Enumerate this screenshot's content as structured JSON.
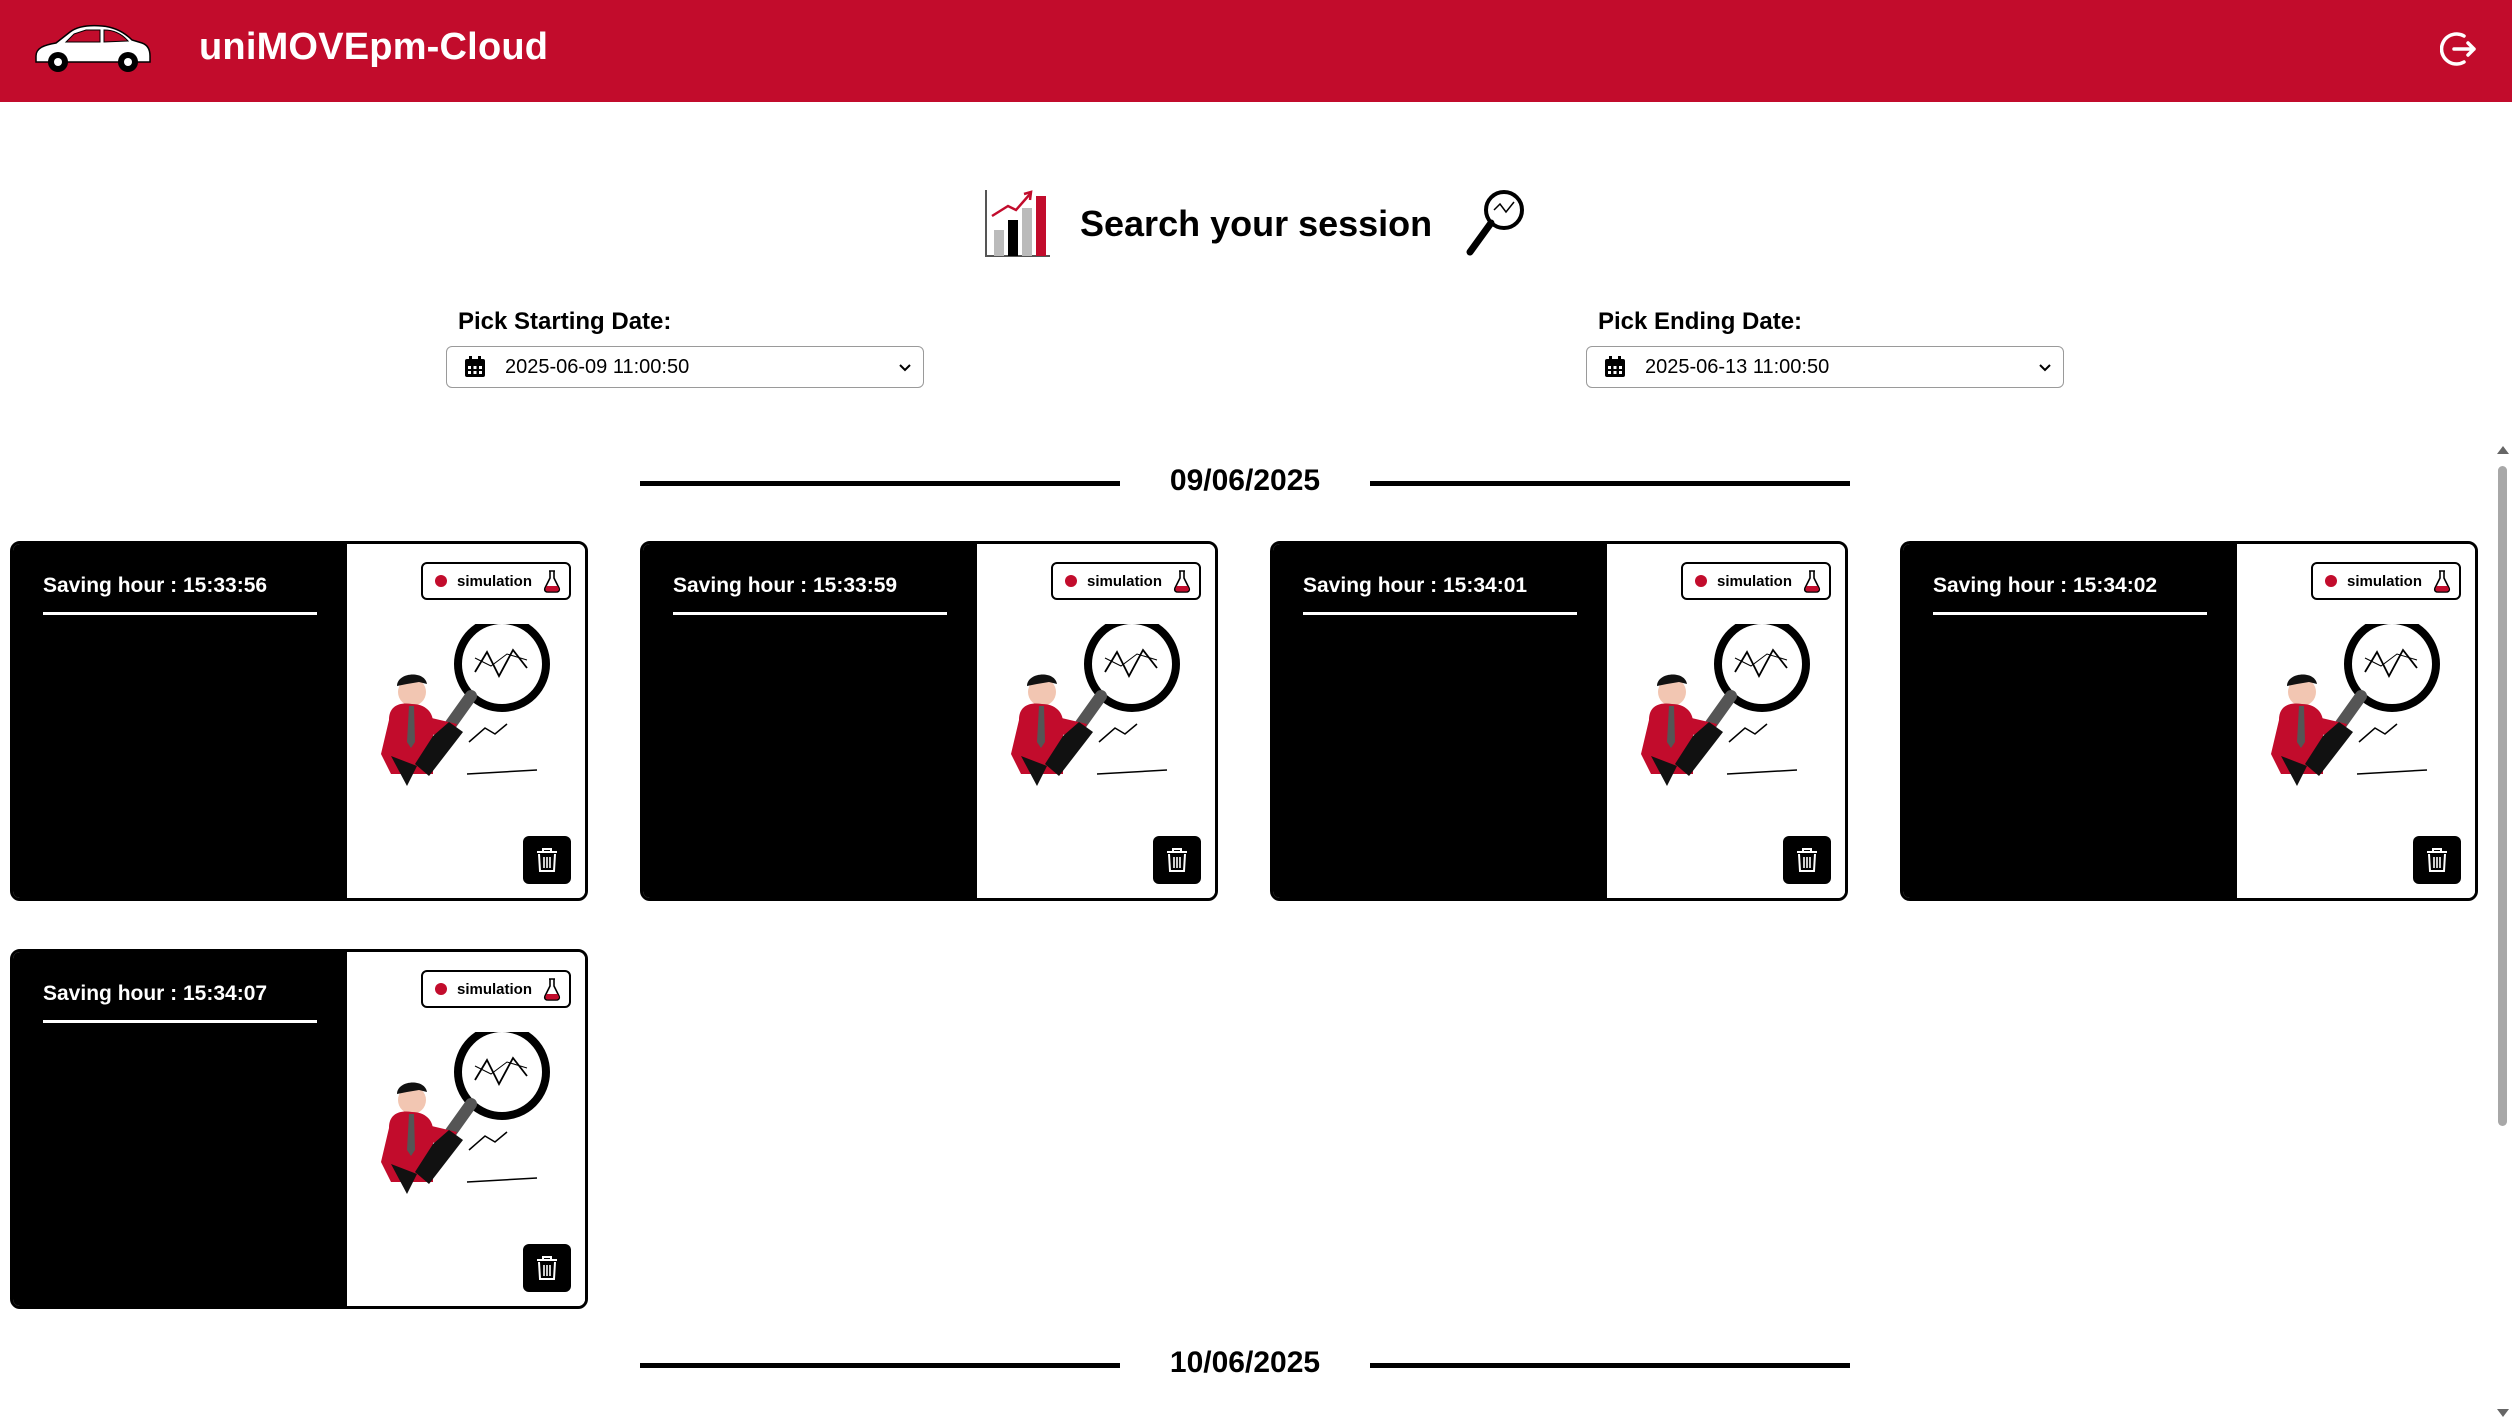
{
  "app": {
    "title": "uniMOVEpm-Cloud"
  },
  "search": {
    "title": "Search your session",
    "start_label": "Pick Starting Date:",
    "start_value": "2025-06-09 11:00:50",
    "end_label": "Pick Ending Date:",
    "end_value": "2025-06-13 11:00:50"
  },
  "groups": [
    {
      "date": "09/06/2025",
      "sessions": [
        {
          "hour": "Saving hour : 15:33:56",
          "badge": "simulation"
        },
        {
          "hour": "Saving hour : 15:33:59",
          "badge": "simulation"
        },
        {
          "hour": "Saving hour : 15:34:01",
          "badge": "simulation"
        },
        {
          "hour": "Saving hour : 15:34:02",
          "badge": "simulation"
        },
        {
          "hour": "Saving hour : 15:34:07",
          "badge": "simulation"
        }
      ]
    },
    {
      "date": "10/06/2025",
      "sessions": []
    }
  ],
  "colors": {
    "brand": "#c20c2c",
    "card_left": "#000000",
    "text_on_dark": "#ffffff"
  },
  "icons": [
    "car-icon",
    "logout-icon",
    "bar-chart-icon",
    "magnifier-icon",
    "calendar-icon",
    "chevron-down-icon",
    "record-dot-icon",
    "flask-icon",
    "analyst-illustration",
    "trash-icon"
  ]
}
